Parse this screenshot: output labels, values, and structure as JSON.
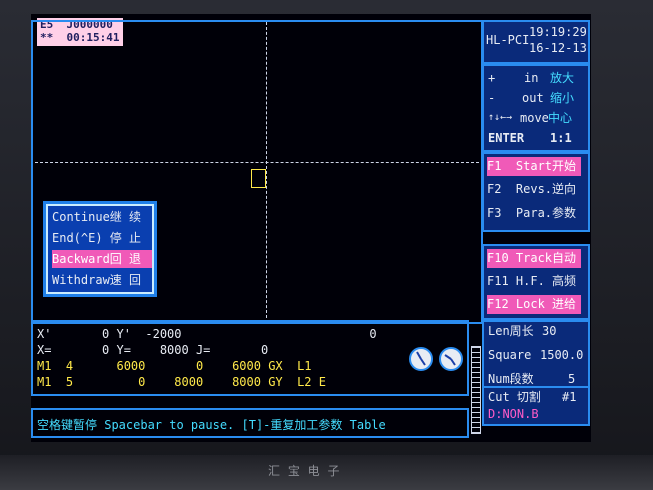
{
  "status": {
    "line1": "E5  J000000",
    "line2": "**  00:15:41"
  },
  "header": {
    "model": "HL-PCI",
    "time": "19:19:29",
    "date": "16-12-13"
  },
  "zoom_panel": {
    "items": [
      {
        "key": "+",
        "label": "in",
        "cn": "放大"
      },
      {
        "key": "-",
        "label": "out",
        "cn": "缩小"
      },
      {
        "key": "↑↓←→",
        "label": "move",
        "cn": "中心"
      },
      {
        "key": "ENTER",
        "label": "",
        "cn": "1:1"
      }
    ]
  },
  "function_keys": [
    {
      "label": "F1  Start开始",
      "highlight": true
    },
    {
      "label": "F2  Revs.逆向",
      "highlight": false
    },
    {
      "label": "F3  Para.参数",
      "highlight": false
    },
    {
      "label": "F10 Track自动",
      "highlight": true
    },
    {
      "label": "F11 H.F. 高频",
      "highlight": false
    },
    {
      "label": "F12 Lock 进给",
      "highlight": true
    }
  ],
  "popup_menu": {
    "items": [
      {
        "label": "Continue继 续",
        "active": false
      },
      {
        "label": "End(^E) 停 止",
        "active": false
      },
      {
        "label": "Backward回 退",
        "active": true
      },
      {
        "label": "Withdraw速 回",
        "active": false
      }
    ]
  },
  "coords": {
    "line1": "X'       0 Y'  -2000                          0",
    "line2": "X=       0 Y=    8000 J=       0",
    "line3": "M1  4      6000       0    6000 GX  L1",
    "line4": "M1  5         0    8000    8000 GY  L2 E"
  },
  "params": {
    "len_label": "Len周长",
    "len_value": "30",
    "square_label": "Square",
    "square_value": "1500.0",
    "num_label": "Num段数",
    "num_value": "5",
    "cut_label": "Cut 切割",
    "cut_value": "#1",
    "file": "D:NON.B"
  },
  "footer": {
    "message": "空格键暂停 Spacebar to pause. [T]-重复加工参数 Table"
  },
  "bezel": {
    "brand": "汇 宝 电 子"
  },
  "colors": {
    "background": "#000008",
    "frame": "#2a8cf0",
    "highlight": "#f05ab8",
    "coords_text": "#ffe94a",
    "panel_text": "#44dcff"
  }
}
